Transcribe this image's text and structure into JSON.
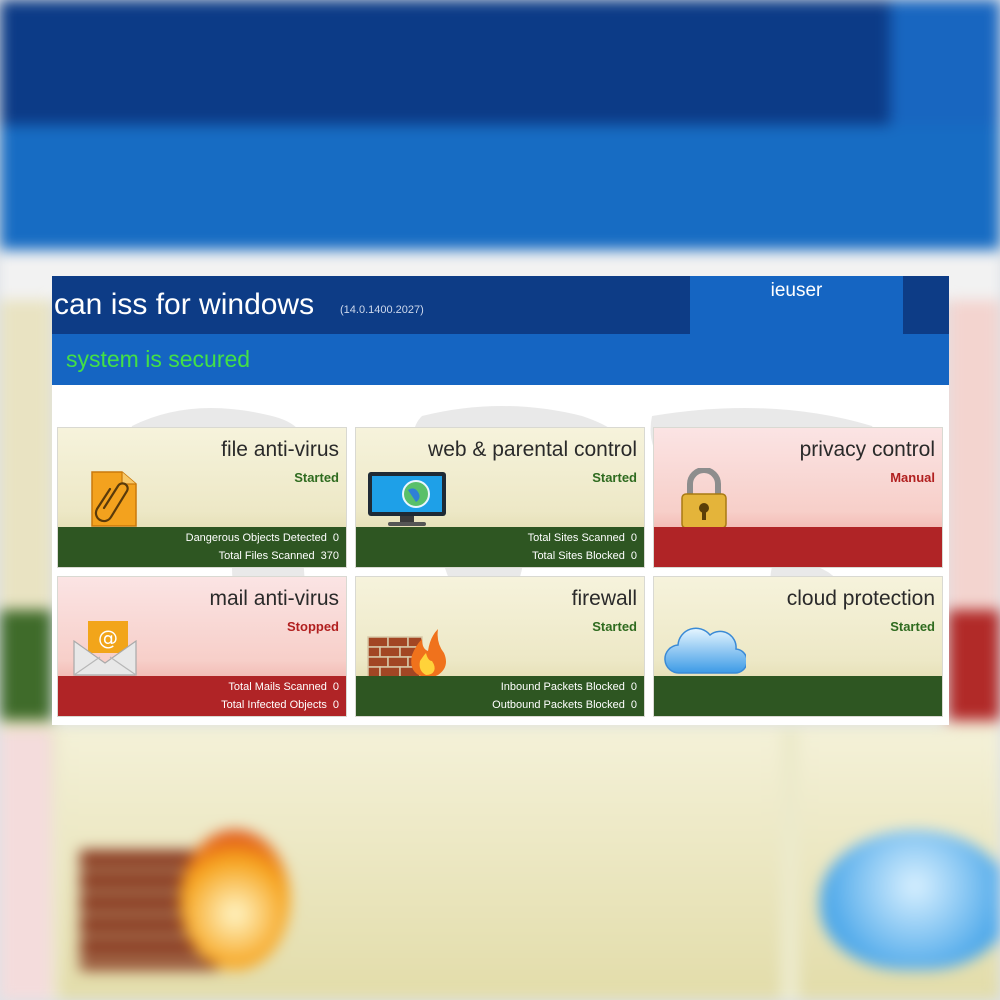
{
  "app": {
    "title": "can iss for windows",
    "version": "(14.0.1400.2027)",
    "user": "ieuser",
    "status": "system is secured"
  },
  "colors": {
    "header_dark": "#0d3c86",
    "header_blue": "#1565c2",
    "status_green_text": "#43e046",
    "footer_green": "#2e5622",
    "footer_red": "#b02426",
    "state_started": "#2f6b1f",
    "state_stopped": "#b11f1f"
  },
  "tiles": [
    {
      "name": "file anti-virus",
      "state": "Started",
      "icon": "document-paperclip-icon",
      "stats": [
        {
          "label": "Dangerous Objects Detected",
          "value": "0"
        },
        {
          "label": "Total Files Scanned",
          "value": "370"
        }
      ]
    },
    {
      "name": "web & parental control",
      "state": "Started",
      "icon": "monitor-globe-icon",
      "stats": [
        {
          "label": "Total Sites Scanned",
          "value": "0"
        },
        {
          "label": "Total Sites Blocked",
          "value": "0"
        }
      ]
    },
    {
      "name": "privacy control",
      "state": "Manual",
      "icon": "padlock-icon",
      "stats": []
    },
    {
      "name": "mail anti-virus",
      "state": "Stopped",
      "icon": "envelope-at-icon",
      "stats": [
        {
          "label": "Total Mails Scanned",
          "value": "0"
        },
        {
          "label": "Total Infected Objects",
          "value": "0"
        }
      ]
    },
    {
      "name": "firewall",
      "state": "Started",
      "icon": "brick-wall-fire-icon",
      "stats": [
        {
          "label": "Inbound Packets Blocked",
          "value": "0"
        },
        {
          "label": "Outbound Packets Blocked",
          "value": "0"
        }
      ]
    },
    {
      "name": "cloud protection",
      "state": "Started",
      "icon": "cloud-icon",
      "stats": []
    }
  ]
}
